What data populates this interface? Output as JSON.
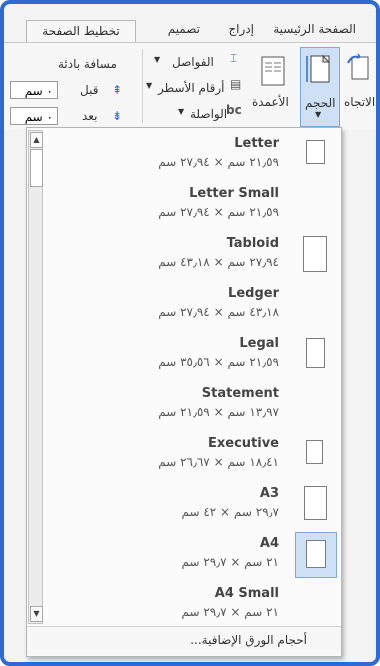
{
  "tabs": {
    "home": "الصفحة الرئيسية",
    "insert": "إدراج",
    "design": "تصميم",
    "layout": "تخطيط الصفحة"
  },
  "ribbon": {
    "orientation": "الاتجاه",
    "size": "الحجم",
    "columns": "الأعمدة",
    "breaks": "الفواصل",
    "line_numbers": "أرقام الأسطر",
    "hyphenation": "الواصلة",
    "spacing_title": "مسافة بادئة",
    "before_label": "قبل",
    "after_label": "بعد",
    "before_value": "٠ سم",
    "after_value": "٠ سم"
  },
  "paper_sizes": [
    {
      "name": "Letter",
      "dims": "٢١٫٥٩ سم × ٢٧٫٩٤ سم"
    },
    {
      "name": "Letter Small",
      "dims": "٢١٫٥٩ سم × ٢٧٫٩٤ سم"
    },
    {
      "name": "Tabloid",
      "dims": "٢٧٫٩٤ سم × ٤٣٫١٨ سم"
    },
    {
      "name": "Ledger",
      "dims": "٤٣٫١٨ سم × ٢٧٫٩٤ سم"
    },
    {
      "name": "Legal",
      "dims": "٢١٫٥٩ سم × ٣٥٫٥٦ سم"
    },
    {
      "name": "Statement",
      "dims": "١٣٫٩٧ سم × ٢١٫٥٩ سم"
    },
    {
      "name": "Executive",
      "dims": "١٨٫٤١ سم × ٢٦٫٦٧ سم"
    },
    {
      "name": "A3",
      "dims": "٢٩٫٧ سم × ٤٢ سم"
    },
    {
      "name": "A4",
      "dims": "٢١ سم × ٢٩٫٧ سم"
    },
    {
      "name": "A4 Small",
      "dims": "٢١ سم × ٢٩٫٧ سم"
    }
  ],
  "selected": "A4",
  "footer": {
    "more_sizes": "أحجام الورق الإضافية..."
  },
  "colors": {
    "frame": "#2f6ad1",
    "selection": "#cde0f5"
  }
}
